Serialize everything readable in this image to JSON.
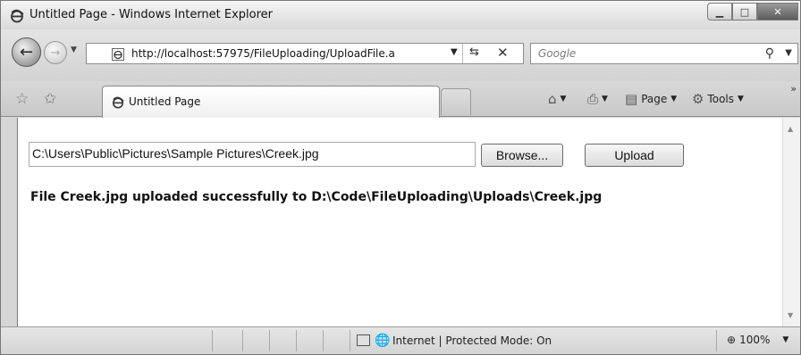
{
  "window": {
    "title": "Untitled Page - Windows Internet Explorer"
  },
  "navigation": {
    "address_url": "http://localhost:57975/FileUploading/UploadFile.a",
    "search_placeholder": "Google"
  },
  "tabs": [
    {
      "title": "Untitled Page",
      "active": true
    }
  ],
  "commands": {
    "page_label": "Page",
    "tools_label": "Tools"
  },
  "content": {
    "file_path": "C:\\Users\\Public\\Pictures\\Sample Pictures\\Creek.jpg",
    "browse_label": "Browse...",
    "upload_label": "Upload",
    "result_message": "File Creek.jpg uploaded successfully to D:\\Code\\FileUploading\\Uploads\\Creek.jpg"
  },
  "status_bar": {
    "zone_text": "Internet | Protected Mode: On",
    "zoom_text": "100%"
  },
  "icons": {
    "ie": "ie-logo-icon",
    "back": "back-arrow-icon",
    "forward": "forward-arrow-icon",
    "refresh": "refresh-icon",
    "stop": "stop-icon",
    "search": "search-icon",
    "favorites": "favorites-star-icon",
    "add_favorites": "add-favorites-icon",
    "home": "home-icon",
    "print": "print-icon",
    "page": "page-icon",
    "tools": "gear-icon",
    "globe": "globe-icon",
    "zoom": "zoom-icon"
  }
}
